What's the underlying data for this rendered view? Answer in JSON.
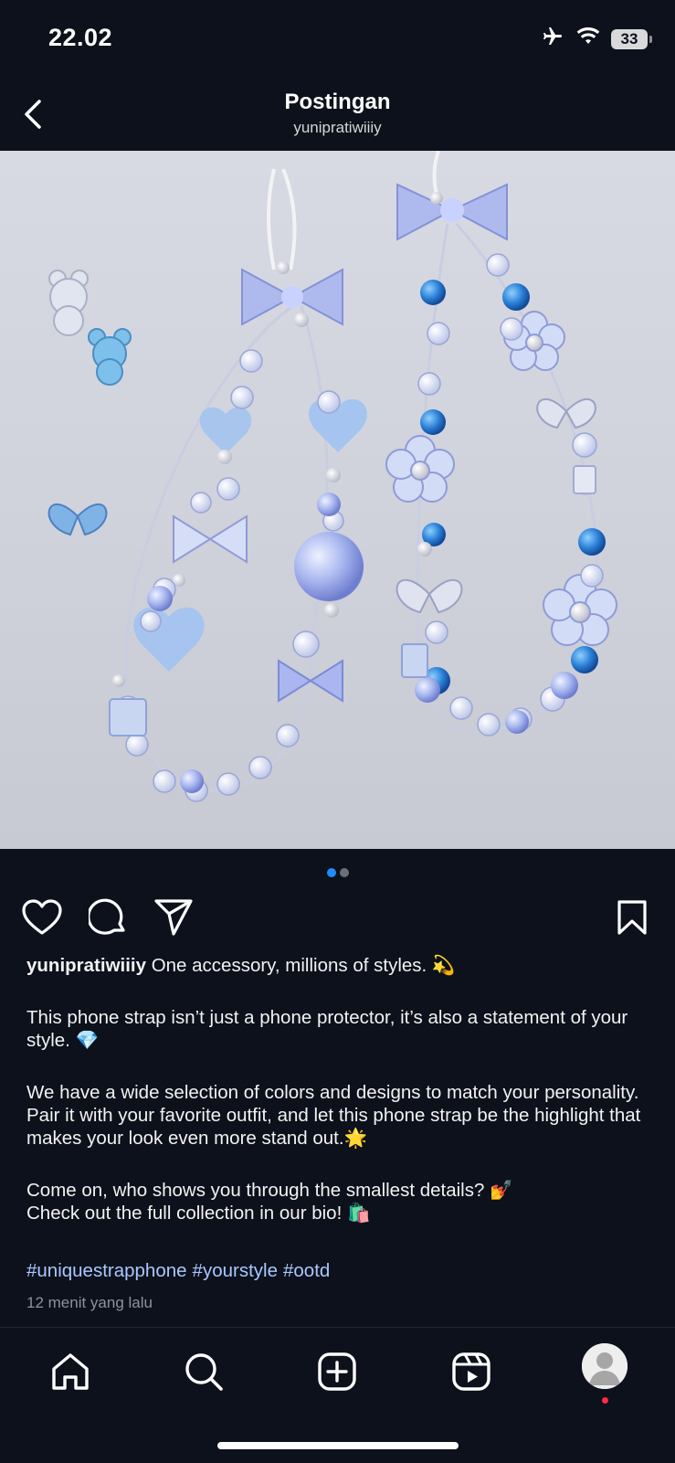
{
  "status": {
    "time": "22.02",
    "battery": "33",
    "icons": [
      "airplane-icon",
      "wifi-icon",
      "battery-icon"
    ]
  },
  "nav": {
    "title": "Postingan",
    "username": "yunipratiwiiiy",
    "back_icon": "chevron-left-icon"
  },
  "post": {
    "image_alt": "Blue and clear beaded phone straps with bows, butterflies and bears",
    "carousel": {
      "count": 2,
      "active": 1
    },
    "actions": [
      "heart-icon",
      "comment-icon",
      "share-icon",
      "bookmark-icon"
    ],
    "caption": {
      "user": "yunipratiwiiiy",
      "line1": "One accessory, millions of styles. 💫",
      "para2": "This phone strap isn’t just a phone protector, it’s also a statement of your style. 💎",
      "para3": "We have a wide selection of colors and designs to match your personality. Pair it with your favorite outfit, and let this phone strap be the highlight that makes your look even more stand out.🌟",
      "para4a": "Come on, who shows you through the smallest details? 💅",
      "para4b": "Check out the full collection in our bio! 🛍️"
    },
    "hashtags": [
      "#uniquestrapphone",
      "#yourstyle",
      "#ootd"
    ],
    "time_ago": "12 menit yang lalu"
  },
  "bottom_nav": [
    "home-icon",
    "search-icon",
    "create-icon",
    "reels-icon",
    "profile-avatar"
  ],
  "colors": {
    "background": "#0c111b",
    "hashtag": "#a9c7ff",
    "dot_active": "#1f8bff",
    "notification": "#ff2b40"
  }
}
